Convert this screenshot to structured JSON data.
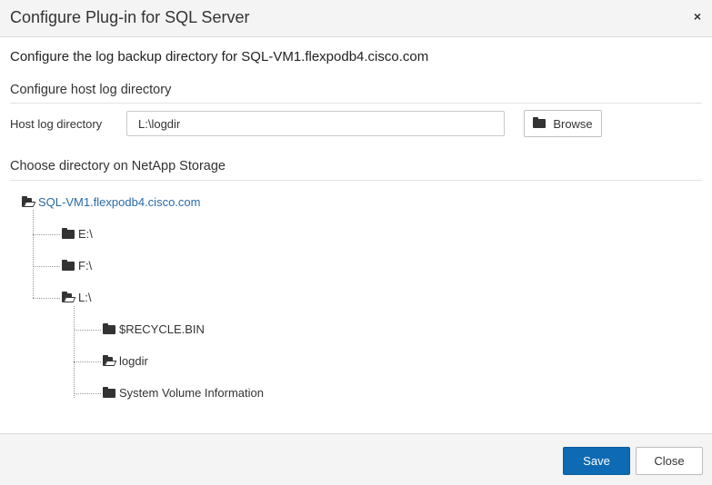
{
  "dialog": {
    "title": "Configure Plug-in for SQL Server",
    "close_symbol": "×"
  },
  "log_backup": {
    "heading": "Configure the log backup directory for SQL-VM1.flexpodb4.cisco.com"
  },
  "host_log": {
    "section_title": "Configure host log directory",
    "field_label": "Host log directory",
    "value": "L:\\logdir",
    "browse_label": "Browse"
  },
  "storage": {
    "section_title": "Choose directory on NetApp Storage",
    "tree": {
      "root": {
        "label": "SQL-VM1.flexpodb4.cisco.com",
        "icon": "folder-open-icon"
      },
      "children": [
        {
          "label": "E:\\",
          "icon": "folder-icon"
        },
        {
          "label": "F:\\",
          "icon": "folder-icon"
        },
        {
          "label": "L:\\",
          "icon": "folder-open-icon",
          "children": [
            {
              "label": "$RECYCLE.BIN",
              "icon": "folder-icon"
            },
            {
              "label": "logdir",
              "icon": "folder-open-icon"
            },
            {
              "label": "System Volume Information",
              "icon": "folder-icon"
            }
          ]
        }
      ]
    }
  },
  "footer": {
    "save_label": "Save",
    "close_label": "Close"
  },
  "colors": {
    "primary_button": "#0f6ab4",
    "link": "#2a6aa8"
  }
}
